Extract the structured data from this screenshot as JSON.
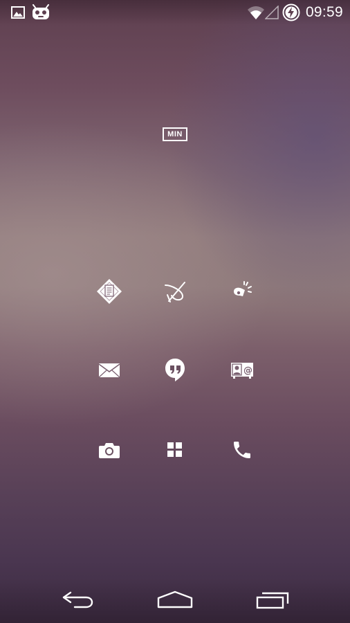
{
  "status_bar": {
    "time": "09:59",
    "left_icons": [
      "image-icon",
      "cyanogenmod-bugdroid-icon"
    ],
    "right_icons": [
      "wifi-icon",
      "cell-signal-icon",
      "battery-charging-icon"
    ]
  },
  "widget": {
    "label": "MIN"
  },
  "home_icons": [
    [
      "diamond-doc-icon",
      "crossed-curve-icon",
      "flashlight-icon"
    ],
    [
      "mail-icon",
      "hangouts-icon",
      "contacts-icon"
    ],
    [
      "camera-icon",
      "grid-apps-icon",
      "phone-icon"
    ]
  ],
  "nav_bar": [
    "back-icon",
    "home-icon",
    "recents-icon"
  ],
  "colors": {
    "foreground": "#ffffff",
    "wallpaper_top": "#5e3f4f",
    "wallpaper_mid": "#917b7c",
    "wallpaper_bottom": "#3c2b40"
  }
}
